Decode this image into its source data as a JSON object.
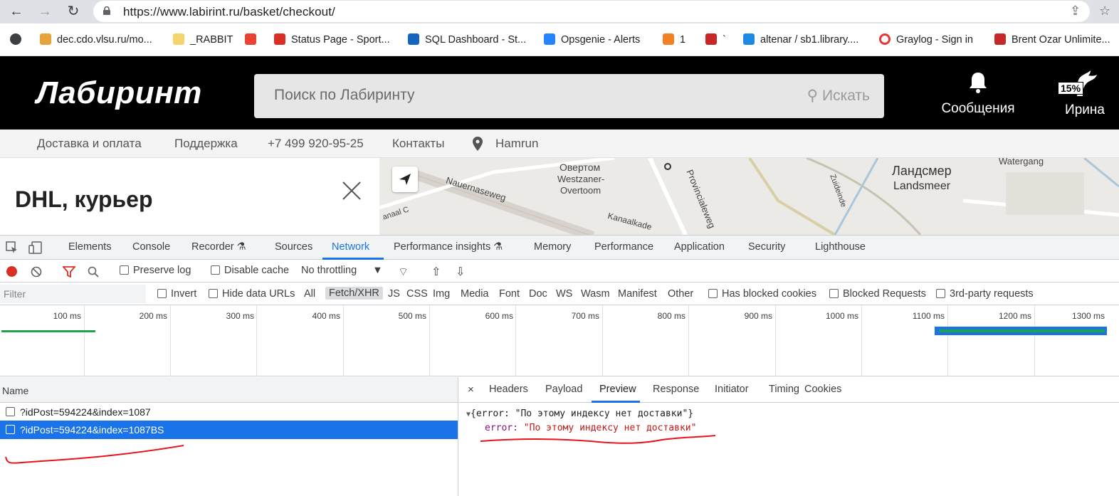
{
  "browser": {
    "url": "https://www.labirint.ru/basket/checkout/",
    "bookmarks": [
      {
        "label": "dec.cdo.vlsu.ru/mo...",
        "color": "#e8a33c"
      },
      {
        "label": "_RABBIT",
        "color": "#f6d36b"
      },
      {
        "label": "",
        "color": "#ea4335"
      },
      {
        "label": "Status Page - Sport...",
        "color": "#d93025"
      },
      {
        "label": "SQL Dashboard - St...",
        "color": "#1565c0"
      },
      {
        "label": "Opsgenie - Alerts",
        "color": "#2684ff"
      },
      {
        "label": "1",
        "color": "#f48024"
      },
      {
        "label": "`",
        "color": "#c62828"
      },
      {
        "label": "altenar / sb1.library....",
        "color": "#1e88e5"
      },
      {
        "label": "Graylog - Sign in",
        "color": "#e53935"
      },
      {
        "label": "Brent Ozar Unlimite...",
        "color": "#c62828"
      }
    ]
  },
  "site": {
    "logo": "Лабиринт",
    "search_placeholder": "Поиск по Лабиринту",
    "search_button": "Искать",
    "messages_label": "Сообщения",
    "user_label": "Ирина",
    "user_badge": "15%",
    "nav": [
      "Доставка и оплата",
      "Поддержка",
      "+7 499 920-95-25",
      "Контакты",
      "Hamrun"
    ],
    "panel_title": "DHL, курьер",
    "map_labels": [
      "Овертом",
      "Westzaner-",
      "Overtoom",
      "Nauernaseweg",
      "Provincialeweg",
      "Zuideinde",
      "Ландсмер",
      "Landsmeer",
      "Watergang",
      "Kanaalkade",
      "anaal C"
    ]
  },
  "devtools": {
    "tabs": [
      "Elements",
      "Console",
      "Recorder",
      "Sources",
      "Network",
      "Performance insights",
      "Memory",
      "Performance",
      "Application",
      "Security",
      "Lighthouse"
    ],
    "active_tab": "Network",
    "toolbar": {
      "preserve_log": "Preserve log",
      "disable_cache": "Disable cache",
      "throttling": "No throttling"
    },
    "filter": {
      "placeholder": "Filter",
      "invert": "Invert",
      "hide_data_urls": "Hide data URLs",
      "types": [
        "All",
        "Fetch/XHR",
        "JS",
        "CSS",
        "Img",
        "Media",
        "Font",
        "Doc",
        "WS",
        "Wasm",
        "Manifest",
        "Other"
      ],
      "selected_type": "Fetch/XHR",
      "has_blocked_cookies": "Has blocked cookies",
      "blocked_requests": "Blocked Requests",
      "third_party": "3rd-party requests"
    },
    "timeline_ticks": [
      "100 ms",
      "200 ms",
      "300 ms",
      "400 ms",
      "500 ms",
      "600 ms",
      "700 ms",
      "800 ms",
      "900 ms",
      "1000 ms",
      "1100 ms",
      "1200 ms",
      "1300 ms"
    ],
    "requests_header": "Name",
    "requests": [
      {
        "name": "?idPost=594224&index=1087",
        "selected": false
      },
      {
        "name": "?idPost=594224&index=1087BS",
        "selected": true
      }
    ],
    "preview_tabs": [
      "Headers",
      "Payload",
      "Preview",
      "Response",
      "Initiator",
      "Timing",
      "Cookies"
    ],
    "active_preview_tab": "Preview",
    "preview": {
      "summary": "{error: \"По этому индексу нет доставки\"}",
      "key": "error",
      "value": "\"По этому индексу нет доставки\""
    }
  },
  "colors": {
    "accent": "#1a73e8",
    "annotation": "#e8141b",
    "record": "#d93025"
  }
}
